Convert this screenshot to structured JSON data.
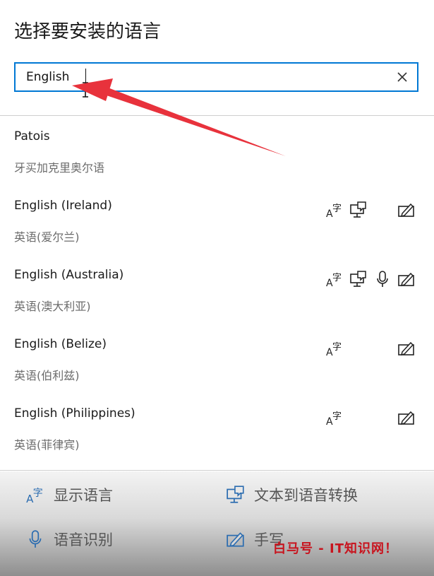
{
  "dialog": {
    "title": "选择要安装的语言"
  },
  "search": {
    "value": "English",
    "placeholder": ""
  },
  "languages": [
    {
      "name": "Patois",
      "native": "牙买加克里奥尔语",
      "features": []
    },
    {
      "name": "English (Ireland)",
      "native": "英语(爱尔兰)",
      "features": [
        "display-language-icon",
        "text-to-speech-icon",
        "handwriting-icon"
      ]
    },
    {
      "name": "English (Australia)",
      "native": "英语(澳大利亚)",
      "features": [
        "display-language-icon",
        "text-to-speech-icon",
        "speech-recognition-icon",
        "handwriting-icon"
      ]
    },
    {
      "name": "English (Belize)",
      "native": "英语(伯利兹)",
      "features": [
        "display-language-icon",
        "handwriting-icon"
      ]
    },
    {
      "name": "English (Philippines)",
      "native": "英语(菲律宾)",
      "features": [
        "display-language-icon",
        "handwriting-icon"
      ]
    }
  ],
  "legend": {
    "display_language": "显示语言",
    "text_to_speech": "文本到语音转换",
    "speech_recognition": "语音识别",
    "handwriting": "手写"
  },
  "watermark": "白马号 - IT知识网！",
  "colors": {
    "accent": "#0078d4",
    "annotation_arrow": "#e8323c",
    "watermark": "#c8141e"
  }
}
